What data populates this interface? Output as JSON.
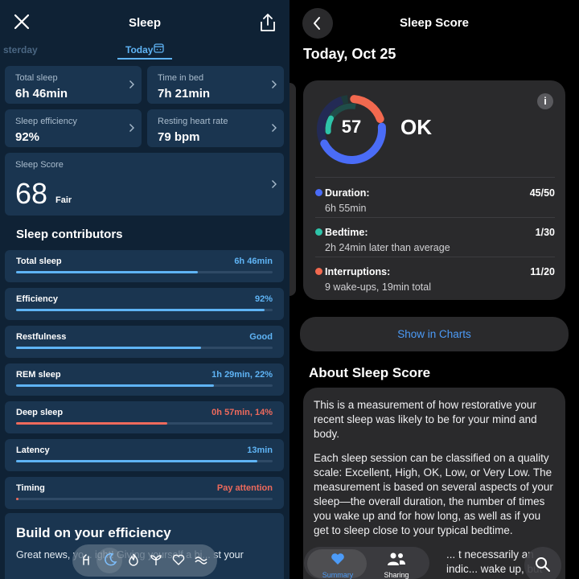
{
  "left": {
    "header": {
      "title": "Sleep"
    },
    "day_nav": {
      "previous": "sterday",
      "current": "Today"
    },
    "stats": [
      {
        "label": "Total sleep",
        "value": "6h 46min"
      },
      {
        "label": "Time in bed",
        "value": "7h 21min"
      },
      {
        "label": "Sleep efficiency",
        "value": "92%"
      },
      {
        "label": "Resting heart rate",
        "value": "79 bpm"
      }
    ],
    "score": {
      "label": "Sleep Score",
      "value": "68",
      "rating": "Fair"
    },
    "contributors_title": "Sleep contributors",
    "contributors": [
      {
        "label": "Total sleep",
        "value": "6h 46min",
        "fill": 0.71,
        "status": "ok"
      },
      {
        "label": "Efficiency",
        "value": "92%",
        "fill": 0.97,
        "status": "ok"
      },
      {
        "label": "Restfulness",
        "value": "Good",
        "fill": 0.72,
        "status": "ok"
      },
      {
        "label": "REM sleep",
        "value": "1h 29min, 22%",
        "fill": 0.77,
        "status": "ok"
      },
      {
        "label": "Deep sleep",
        "value": "0h 57min, 14%",
        "fill": 0.59,
        "status": "warn"
      },
      {
        "label": "Latency",
        "value": "13min",
        "fill": 0.94,
        "status": "ok"
      },
      {
        "label": "Timing",
        "value": "Pay attention",
        "fill": 0.01,
        "status": "warn"
      }
    ],
    "build": {
      "title": "Build on your efficiency",
      "text": "Great news, yo... ight! Giving yourself a bi... st your"
    },
    "dock_icons": [
      "activity-icon",
      "moon-icon",
      "flame-icon",
      "plant-icon",
      "heart-icon",
      "wave-icon"
    ]
  },
  "right": {
    "header": {
      "title": "Sleep Score"
    },
    "date": "Today, Oct 25",
    "info_icon": "i",
    "score": {
      "value": "57",
      "rating": "OK"
    },
    "metrics": [
      {
        "label": "Duration:",
        "sub": "6h 55min",
        "score": "45/50",
        "color": "#4a6cf7"
      },
      {
        "label": "Bedtime:",
        "sub": "2h 24min later than average",
        "score": "1/30",
        "color": "#2ec4a9"
      },
      {
        "label": "Interruptions:",
        "sub": "9 wake-ups, 19min total",
        "score": "11/20",
        "color": "#f2694f"
      }
    ],
    "ring": {
      "duration": 0.9,
      "bedtime": 0.033,
      "interruptions": 0.55
    },
    "show_button": "Show in Charts",
    "about_title": "About Sleep Score",
    "about_paragraphs": [
      "This is a measurement of how restorative your recent sleep was likely to be for your mind and body.",
      "Each sleep session can be classified on a quality scale: Excellent, High, OK, Low, or Very Low. The measurement is based on several aspects of your sleep—the overall duration, the number of times you wake up and for how long, as well as if you get to sleep close to your typical bedtime.",
      "... t necessarily an indic... wake up, but can"
    ],
    "tabs": [
      {
        "label": "Summary",
        "icon": "heart-icon"
      },
      {
        "label": "Sharing",
        "icon": "people-icon"
      }
    ],
    "accent": "#4c9bf7"
  }
}
